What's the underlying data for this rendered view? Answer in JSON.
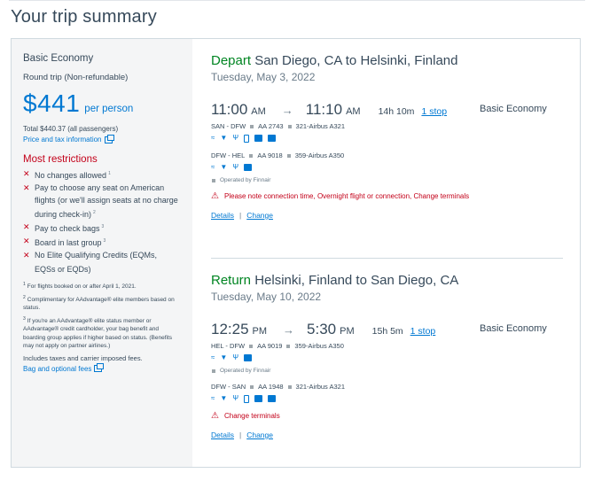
{
  "page_title": "Your trip summary",
  "sidebar": {
    "fare_name": "Basic Economy",
    "trip_type": "Round trip (Non-refundable)",
    "price": "$441",
    "price_suffix": "per person",
    "total": "Total $440.37 (all passengers)",
    "price_tax_link": "Price and tax information",
    "restrictions_title": "Most restrictions",
    "restrictions": [
      {
        "text": "No changes allowed",
        "note": "1"
      },
      {
        "text": "Pay to choose any seat on American flights (or we'll assign seats at no charge during check-in)",
        "note": "2"
      },
      {
        "text": "Pay to check bags",
        "note": "3"
      },
      {
        "text": "Board in last group",
        "note": "3"
      },
      {
        "text": "No Elite Qualifying Credits (EQMs, EQSs or EQDs)",
        "note": ""
      }
    ],
    "notes": [
      {
        "num": "1",
        "text": "For flights booked on or after April 1, 2021."
      },
      {
        "num": "2",
        "text": "Complimentary for AAdvantage® elite members based on status."
      },
      {
        "num": "3",
        "text": "If you're an AAdvantage® elite status member or AAdvantage® credit cardholder, your bag benefit and boarding group applies if higher based on status. (Benefits may not apply on partner airlines.)"
      }
    ],
    "taxes": "Includes taxes and carrier imposed fees.",
    "bag_link": "Bag and optional fees"
  },
  "segments": [
    {
      "verb": "Depart",
      "route": "San Diego, CA to Helsinki, Finland",
      "date": "Tuesday, May 3, 2022",
      "depart_time": "11:00",
      "depart_ampm": "AM",
      "arrive_time": "11:10",
      "arrive_ampm": "AM",
      "duration": "14h 10m",
      "stops": "1 stop",
      "cabin": "Basic Economy",
      "legs": [
        {
          "route": "SAN - DFW",
          "flight": "AA 2743",
          "aircraft": "321-Airbus A321",
          "amenities": [
            "wifi-icon",
            "power-icon",
            "usb-icon",
            "phone-icon",
            "entertainment-icon",
            "app-icon"
          ]
        },
        {
          "route": "DFW - HEL",
          "flight": "AA 9018",
          "aircraft": "359-Airbus A350",
          "amenities": [
            "wifi-icon",
            "power-icon",
            "usb-icon",
            "screen-icon"
          ]
        }
      ],
      "operated_by": "Operated by Finnair",
      "warning": "Please note connection time, Overnight flight or connection, Change terminals",
      "details_label": "Details",
      "change_label": "Change"
    },
    {
      "verb": "Return",
      "route": "Helsinki, Finland to San Diego, CA",
      "date": "Tuesday, May 10, 2022",
      "depart_time": "12:25",
      "depart_ampm": "PM",
      "arrive_time": "5:30",
      "arrive_ampm": "PM",
      "duration": "15h 5m",
      "stops": "1 stop",
      "cabin": "Basic Economy",
      "legs": [
        {
          "route": "HEL - DFW",
          "flight": "AA 9019",
          "aircraft": "359-Airbus A350",
          "amenities": [
            "wifi-icon",
            "power-icon",
            "usb-icon",
            "screen-icon"
          ]
        },
        {
          "route": "DFW - SAN",
          "flight": "AA 1948",
          "aircraft": "321-Airbus A321",
          "amenities": [
            "wifi-icon",
            "power-icon",
            "usb-icon",
            "phone-icon",
            "entertainment-icon",
            "app-icon"
          ]
        }
      ],
      "operated_by": "Operated by Finnair",
      "warning": "Change terminals",
      "details_label": "Details",
      "change_label": "Change"
    }
  ],
  "colors": {
    "brand_blue": "#0078d2",
    "depart_green": "#008522",
    "alert_red": "#c30019"
  }
}
